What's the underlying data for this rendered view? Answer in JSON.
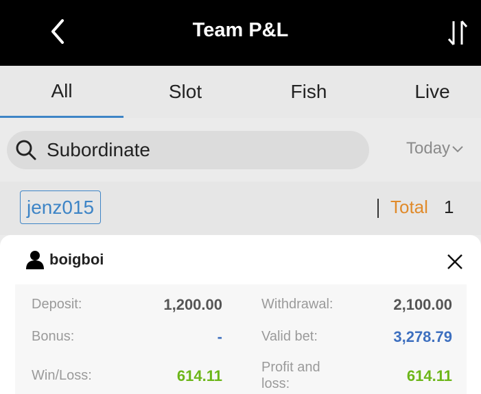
{
  "header": {
    "title": "Team P&L",
    "back_icon": "chevron-left-icon",
    "sort_icon": "sort-arrows-icon"
  },
  "tabs": [
    {
      "label": "All",
      "active": true
    },
    {
      "label": "Slot",
      "active": false
    },
    {
      "label": "Fish",
      "active": false
    },
    {
      "label": "Live",
      "active": false
    }
  ],
  "search": {
    "label": "Subordinate",
    "icon": "search-icon"
  },
  "date_filter": {
    "value": "Today",
    "icon": "chevron-down-icon"
  },
  "filter": {
    "user_tag": "jenz015",
    "total_label": "Total",
    "total_value": "1"
  },
  "detail": {
    "username": "boigboi",
    "stats": {
      "deposit_label": "Deposit:",
      "deposit_value": "1,200.00",
      "withdrawal_label": "Withdrawal:",
      "withdrawal_value": "2,100.00",
      "bonus_label": "Bonus:",
      "bonus_value": "-",
      "valid_bet_label": "Valid bet:",
      "valid_bet_value": "3,278.79",
      "winloss_label": "Win/Loss:",
      "winloss_value": "614.11",
      "pnl_label_line1": "Profit and",
      "pnl_label_line2": "loss:",
      "pnl_value": "614.11"
    }
  },
  "colors": {
    "accent": "#3d84c6",
    "total": "#e08a2a",
    "positive": "#6cb619",
    "bet": "#3d6fbf"
  }
}
